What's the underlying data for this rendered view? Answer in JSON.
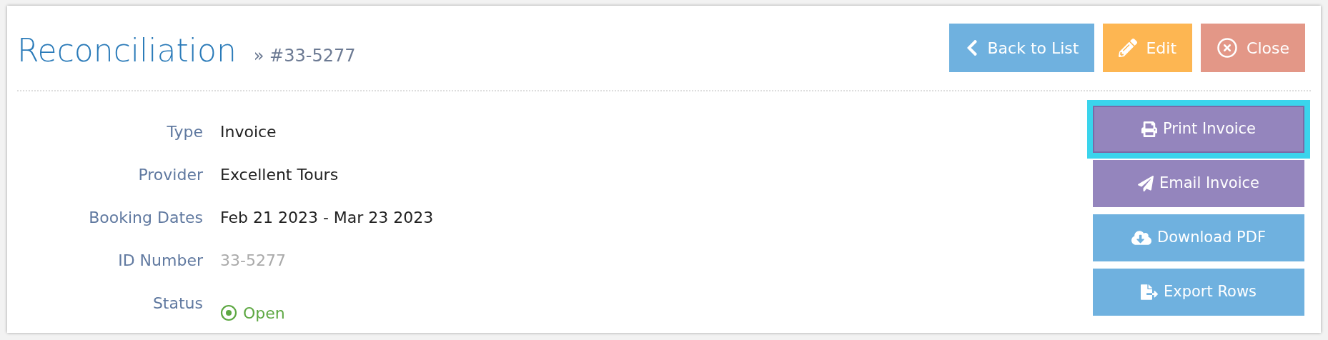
{
  "header": {
    "title": "Reconciliation",
    "subtitle": "» #33-5277"
  },
  "header_buttons": [
    {
      "kind": "back",
      "label": "Back to List",
      "color": "#6fb1df"
    },
    {
      "kind": "edit",
      "label": "Edit",
      "color": "#fdb652"
    },
    {
      "kind": "close",
      "label": "Close",
      "color": "#e39787"
    }
  ],
  "details": [
    {
      "label": "Type",
      "value": "Invoice",
      "kind": "text"
    },
    {
      "label": "Provider",
      "value": "Excellent Tours",
      "kind": "text"
    },
    {
      "label": "Booking Dates",
      "value": "Feb 21 2023 - Mar 23 2023",
      "kind": "text"
    },
    {
      "label": "ID Number",
      "value": "33-5277",
      "kind": "muted"
    },
    {
      "label": "Status",
      "value": "Open",
      "kind": "status"
    }
  ],
  "actions": [
    {
      "kind": "print",
      "label": "Print Invoice",
      "color": "#9485bd",
      "focused": true
    },
    {
      "kind": "email",
      "label": "Email Invoice",
      "color": "#9485bd",
      "focused": false
    },
    {
      "kind": "download",
      "label": "Download PDF",
      "color": "#6fb1df",
      "focused": false
    },
    {
      "kind": "export",
      "label": "Export Rows",
      "color": "#6fb1df",
      "focused": false
    }
  ]
}
